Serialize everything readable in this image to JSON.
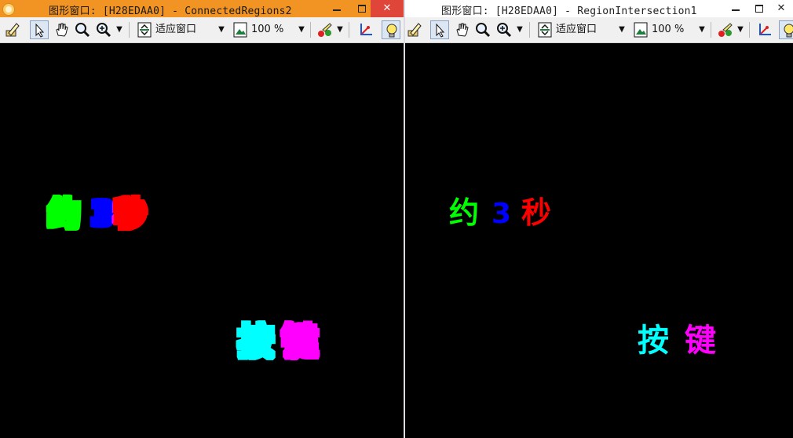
{
  "windows": [
    {
      "title": "图形窗口: [H28EDAA0] - ConnectedRegions2",
      "toolbar": {
        "fit_label": "适应窗口",
        "zoom_label": "100 %"
      }
    },
    {
      "title": "图形窗口: [H28EDAA0] - RegionIntersection1",
      "toolbar": {
        "fit_label": "适应窗口",
        "zoom_label": "100 %"
      }
    }
  ],
  "regions": {
    "text_row1": [
      "约",
      "3",
      "秒"
    ],
    "text_row2": [
      "按",
      "键"
    ],
    "colors": {
      "green": "#00ff00",
      "blue": "#0000ff",
      "red": "#ff0000",
      "cyan": "#00ffff",
      "magenta": "#ff00ff"
    }
  },
  "colors": {
    "active_title": "#f29424",
    "close_button": "#e0453a",
    "canvas": "#000000"
  }
}
